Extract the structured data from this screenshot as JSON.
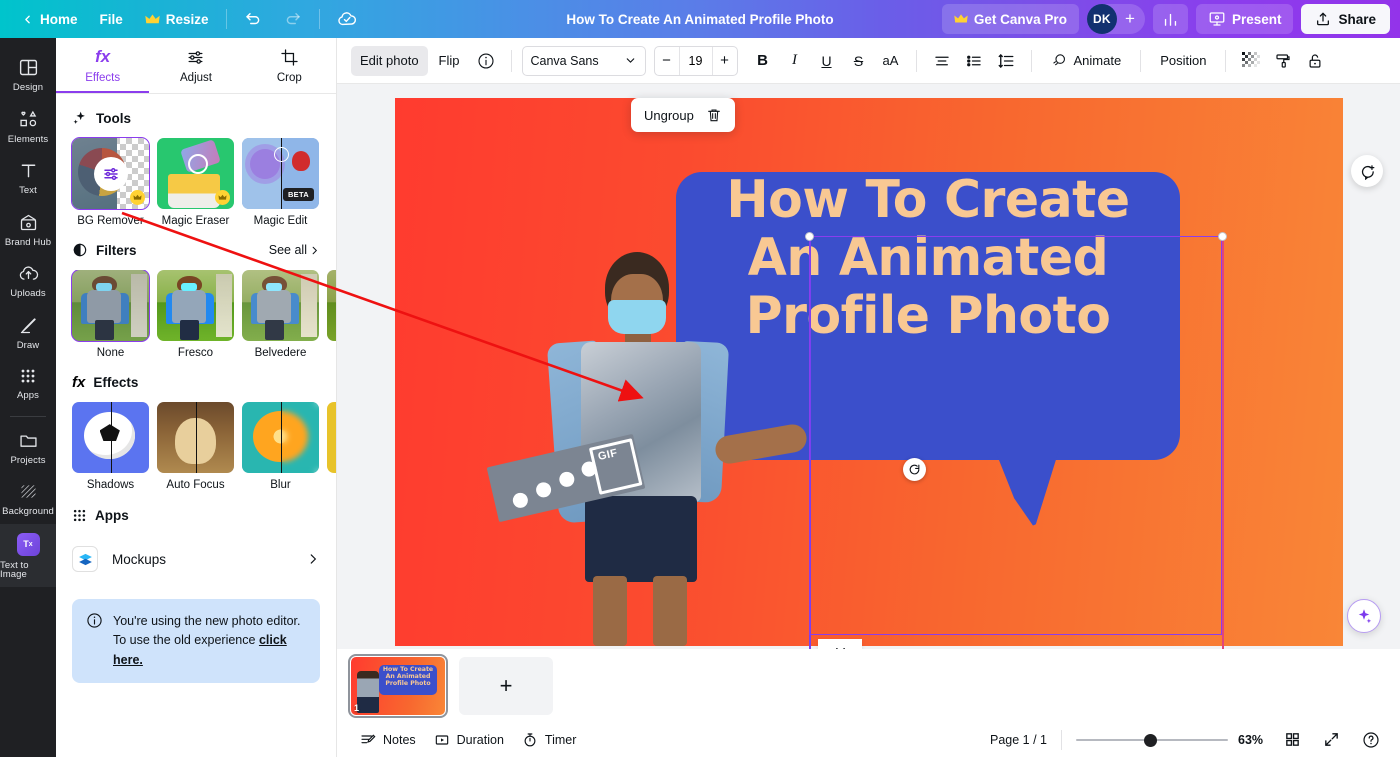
{
  "topbar": {
    "home_label": "Home",
    "file_label": "File",
    "resize_label": "Resize",
    "doc_title": "How To Create An Animated Profile Photo",
    "get_pro_label": "Get Canva Pro",
    "avatar_initials": "DK",
    "plus_label": "+",
    "present_label": "Present",
    "share_label": "Share"
  },
  "rail": {
    "items": [
      {
        "label": "Design"
      },
      {
        "label": "Elements"
      },
      {
        "label": "Text"
      },
      {
        "label": "Brand Hub"
      },
      {
        "label": "Uploads"
      },
      {
        "label": "Draw"
      },
      {
        "label": "Apps"
      },
      {
        "label": "Projects"
      },
      {
        "label": "Background"
      },
      {
        "label": "Text to Image"
      }
    ]
  },
  "panel": {
    "tabs": [
      {
        "label": "Effects",
        "icon": "fx"
      },
      {
        "label": "Adjust",
        "icon": "sliders"
      },
      {
        "label": "Crop",
        "icon": "crop"
      }
    ],
    "tools": {
      "title": "Tools",
      "items": [
        {
          "label": "BG Remover",
          "badge": ""
        },
        {
          "label": "Magic Eraser",
          "badge": "crown"
        },
        {
          "label": "Magic Edit",
          "badge": "BETA"
        }
      ]
    },
    "filters": {
      "title": "Filters",
      "see_all": "See all",
      "items": [
        {
          "label": "None"
        },
        {
          "label": "Fresco"
        },
        {
          "label": "Belvedere"
        },
        {
          "label": ""
        }
      ]
    },
    "effects": {
      "title": "Effects",
      "items": [
        {
          "label": "Shadows"
        },
        {
          "label": "Auto Focus"
        },
        {
          "label": "Blur"
        },
        {
          "label": ""
        }
      ]
    },
    "apps": {
      "title": "Apps",
      "items": [
        {
          "label": "Mockups"
        }
      ]
    },
    "notice": {
      "line1": "You're using the new photo editor.",
      "line2": "To use the old experience ",
      "link": "click here."
    }
  },
  "toolbar": {
    "edit_photo_label": "Edit photo",
    "flip_label": "Flip",
    "font_name": "Canva Sans",
    "font_size": "19",
    "minus_label": "−",
    "plus_label": "+",
    "bold_label": "B",
    "italic_label": "I",
    "underline_label": "U",
    "strike_label": "S",
    "case_label": "aA",
    "animate_label": "Animate",
    "position_label": "Position"
  },
  "canvas": {
    "ungroup_label": "Ungroup",
    "design_text": {
      "line1": "How To Create",
      "line2": "An Animated",
      "line3": "Profile Photo"
    },
    "gif_label": "GIF",
    "colors": {
      "bg_start": "#ff3b2f",
      "bg_end": "#f98637",
      "speech": "#3b4fcb",
      "text": "#f8c893",
      "selection": "#8b3ded",
      "guide_pink": "#e0457b",
      "annotation_arrow": "#ee1111"
    }
  },
  "pages": {
    "thumb_number": "1",
    "thumb_text": "How To Create An Animated Profile Photo",
    "add_label": "+"
  },
  "bottombar": {
    "notes_label": "Notes",
    "duration_label": "Duration",
    "timer_label": "Timer",
    "page_count": "Page 1 / 1",
    "zoom_value": "63%"
  }
}
